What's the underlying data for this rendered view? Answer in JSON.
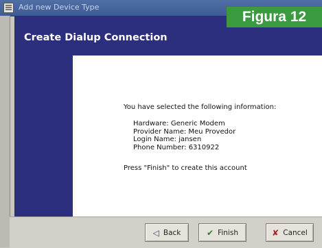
{
  "window": {
    "title": "Add new Device Type",
    "figure_label": "Figura 12"
  },
  "header": {
    "title": "Create Dialup Connection"
  },
  "content": {
    "intro": "You have selected the following information:",
    "details": [
      "Hardware:  Generic Modem",
      "Provider Name:  Meu Provedor",
      "Login Name:  jansen",
      "Phone Number:  6310922"
    ],
    "finish_note": "Press \"Finish\" to create this account"
  },
  "buttons": {
    "back": {
      "label": "Back",
      "icon": "back-arrow-icon"
    },
    "finish": {
      "label": "Finish",
      "icon": "checkmark-icon"
    },
    "cancel": {
      "label": "Cancel",
      "icon": "x-icon"
    }
  },
  "colors": {
    "header_bg": "#2c2f7e",
    "figure_label_bg": "#3a9a3f",
    "titlebar_bg": "#4f6fa6"
  }
}
